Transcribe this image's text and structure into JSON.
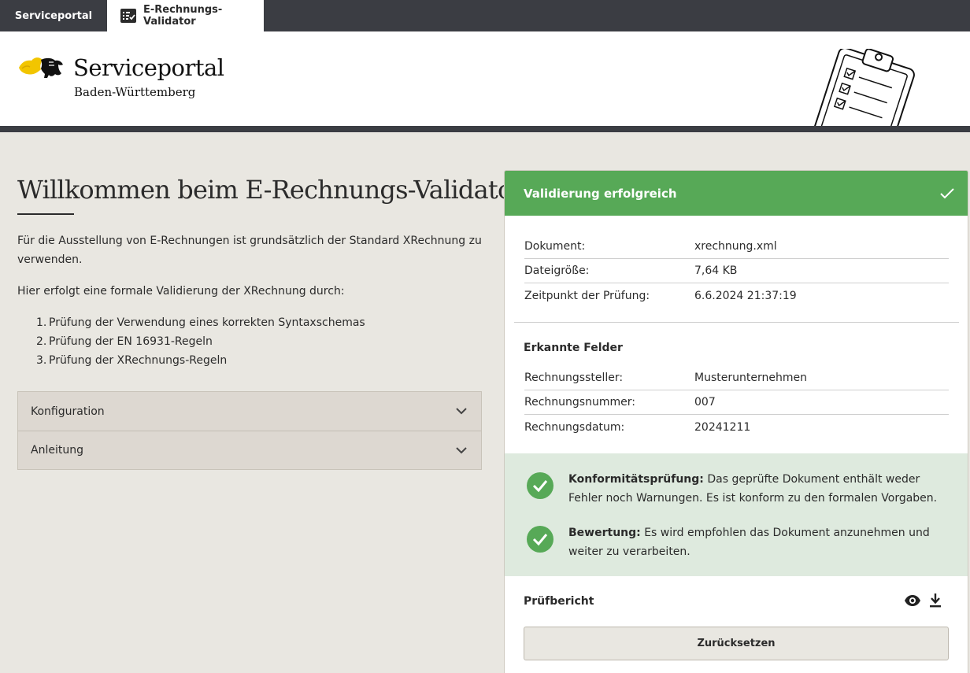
{
  "tabs": {
    "portal_label": "Serviceportal",
    "validator_label": "E-Rechnungs-Validator"
  },
  "header": {
    "logo_title": "Serviceportal",
    "logo_subtitle": "Baden-Württemberg",
    "logo_icon": "lion-coat-of-arms",
    "illustration_icon": "clipboard-checklist-icon"
  },
  "main": {
    "title": "Willkommen beim E-Rechnungs-Validator",
    "intro": "Für die Ausstellung von E-Rechnungen ist grundsätzlich der Standard XRechnung zu verwenden.",
    "intro2": "Hier erfolgt eine formale Validierung der XRechnung durch:",
    "checks": [
      {
        "num": "1.",
        "text": "Prüfung der Verwendung eines korrekten Syntaxschemas"
      },
      {
        "num": "2.",
        "text": "Prüfung der EN 16931-Regeln"
      },
      {
        "num": "3.",
        "text": "Prüfung der XRechnungs-Regeln"
      }
    ],
    "accordion": [
      {
        "label": "Konfiguration"
      },
      {
        "label": "Anleitung"
      }
    ]
  },
  "result": {
    "header_title": "Validierung erfolgreich",
    "status_color": "#57a957",
    "document_rows": [
      {
        "key": "Dokument:",
        "value": "xrechnung.xml"
      },
      {
        "key": "Dateigröße:",
        "value": "7,64 KB"
      },
      {
        "key": "Zeitpunkt der Prüfung:",
        "value": "6.6.2024 21:37:19"
      }
    ],
    "fields_title": "Erkannte Felder",
    "field_rows": [
      {
        "key": "Rechnungssteller:",
        "value": "Musterunternehmen"
      },
      {
        "key": "Rechnungsnummer:",
        "value": "007"
      },
      {
        "key": "Rechnungsdatum:",
        "value": "20241211"
      }
    ],
    "conformity": {
      "label": "Konformitätsprüfung:",
      "text": " Das geprüfte Dokument enthält weder Fehler noch Warnungen. Es ist konform zu den formalen Vorgaben."
    },
    "assessment": {
      "label": "Bewertung:",
      "text": " Es wird empfohlen das Dokument anzunehmen und weiter zu verarbeiten."
    },
    "report_title": "Prüfbericht",
    "reset_label": "Zurücksetzen"
  }
}
